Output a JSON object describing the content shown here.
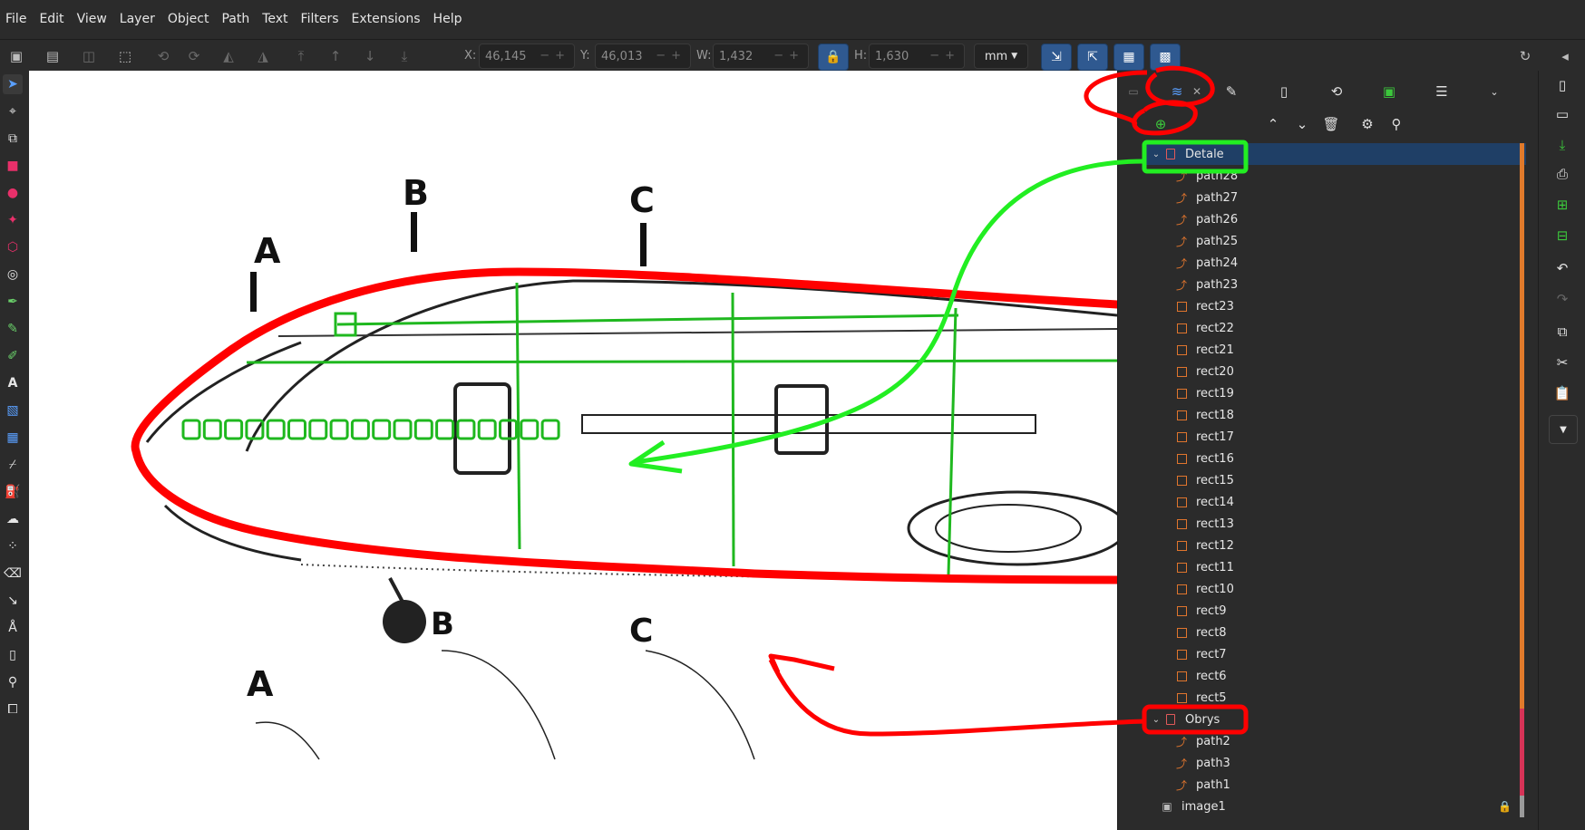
{
  "menubar": {
    "items": [
      "File",
      "Edit",
      "View",
      "Layer",
      "Object",
      "Path",
      "Text",
      "Filters",
      "Extensions",
      "Help"
    ]
  },
  "toolbar": {
    "x_label": "X:",
    "x_value": "46,145",
    "y_label": "Y:",
    "y_value": "46,013",
    "w_label": "W:",
    "w_value": "1,432",
    "h_label": "H:",
    "h_value": "1,630",
    "unit": "mm"
  },
  "layers_panel": {
    "rows": [
      {
        "type": "layer",
        "label": "Detale",
        "expanded": true,
        "selected": true,
        "indent": 0
      },
      {
        "type": "path",
        "label": "path28",
        "indent": 1
      },
      {
        "type": "path",
        "label": "path27",
        "indent": 1
      },
      {
        "type": "path",
        "label": "path26",
        "indent": 1
      },
      {
        "type": "path",
        "label": "path25",
        "indent": 1
      },
      {
        "type": "path",
        "label": "path24",
        "indent": 1
      },
      {
        "type": "path",
        "label": "path23",
        "indent": 1
      },
      {
        "type": "rect",
        "label": "rect23",
        "indent": 1
      },
      {
        "type": "rect",
        "label": "rect22",
        "indent": 1
      },
      {
        "type": "rect",
        "label": "rect21",
        "indent": 1
      },
      {
        "type": "rect",
        "label": "rect20",
        "indent": 1
      },
      {
        "type": "rect",
        "label": "rect19",
        "indent": 1
      },
      {
        "type": "rect",
        "label": "rect18",
        "indent": 1
      },
      {
        "type": "rect",
        "label": "rect17",
        "indent": 1
      },
      {
        "type": "rect",
        "label": "rect16",
        "indent": 1
      },
      {
        "type": "rect",
        "label": "rect15",
        "indent": 1
      },
      {
        "type": "rect",
        "label": "rect14",
        "indent": 1
      },
      {
        "type": "rect",
        "label": "rect13",
        "indent": 1
      },
      {
        "type": "rect",
        "label": "rect12",
        "indent": 1
      },
      {
        "type": "rect",
        "label": "rect11",
        "indent": 1
      },
      {
        "type": "rect",
        "label": "rect10",
        "indent": 1
      },
      {
        "type": "rect",
        "label": "rect9",
        "indent": 1
      },
      {
        "type": "rect",
        "label": "rect8",
        "indent": 1
      },
      {
        "type": "rect",
        "label": "rect7",
        "indent": 1
      },
      {
        "type": "rect",
        "label": "rect6",
        "indent": 1
      },
      {
        "type": "rect",
        "label": "rect5",
        "indent": 1
      },
      {
        "type": "layer",
        "label": "Obrys",
        "expanded": true,
        "selected": false,
        "indent": 0
      },
      {
        "type": "path",
        "label": "path2",
        "indent": 1
      },
      {
        "type": "path",
        "label": "path3",
        "indent": 1
      },
      {
        "type": "path",
        "label": "path1",
        "indent": 1
      },
      {
        "type": "image",
        "label": "image1",
        "indent": 0,
        "locked": true
      }
    ]
  },
  "drawing_labels": {
    "a_top": "A",
    "b_top": "B",
    "c_top": "C",
    "b_bottom": "B",
    "c_bottom": "C",
    "a_bottom": "A"
  },
  "colors": {
    "detale_stripe": "#e07a2b",
    "obrys_stripe": "#d63357",
    "selection": "#1f3f66",
    "annotation_red": "#ff0000",
    "annotation_green": "#22ee22"
  }
}
